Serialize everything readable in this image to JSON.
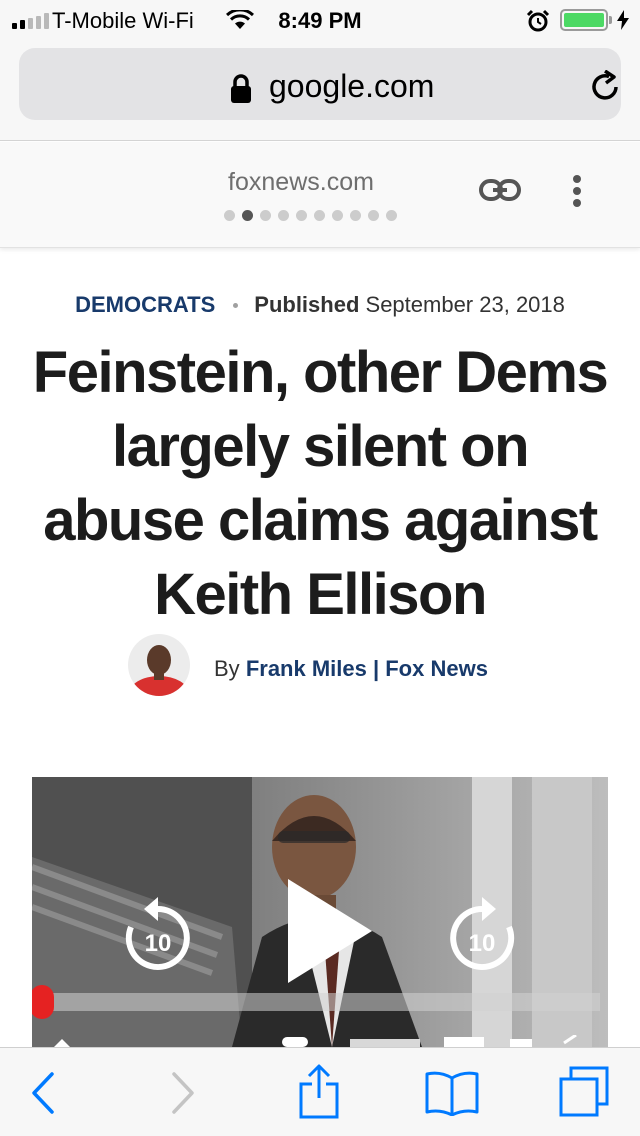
{
  "status_bar": {
    "carrier": "T-Mobile Wi-Fi",
    "time": "8:49 PM",
    "signal_bars_filled": 2,
    "signal_bars_total": 5,
    "battery_level": 1.0,
    "icons": [
      "signal-icon",
      "wifi-icon",
      "alarm-icon",
      "battery-icon",
      "charging-bolt-icon"
    ]
  },
  "url_bar": {
    "url": "google.com",
    "icons": [
      "lock-icon",
      "reload-icon"
    ]
  },
  "amp_header": {
    "domain": "foxnews.com",
    "page_dots_total": 10,
    "page_dots_active_index": 1,
    "icons": [
      "link-icon",
      "more-vertical-icon"
    ]
  },
  "article": {
    "category": "DEMOCRATS",
    "published_label": "Published",
    "published_date": "September 23, 2018",
    "headline": "Feinstein, other Dems largely silent on abuse claims against Keith Ellison",
    "byline_prefix": "By",
    "author": "Frank Miles | Fox News"
  },
  "video": {
    "rewind_seconds": "10",
    "forward_seconds": "10",
    "progress": 0.0,
    "icons": [
      "rewind-10-icon",
      "play-icon",
      "forward-10-icon"
    ]
  },
  "toolbar": {
    "icons": [
      "back-icon",
      "forward-icon",
      "share-icon",
      "bookmarks-icon",
      "tabs-icon"
    ]
  },
  "colors": {
    "brand_navy": "#183a6b",
    "ios_blue": "#007aff",
    "battery_green": "#4cd964",
    "progress_red": "#e02020"
  }
}
